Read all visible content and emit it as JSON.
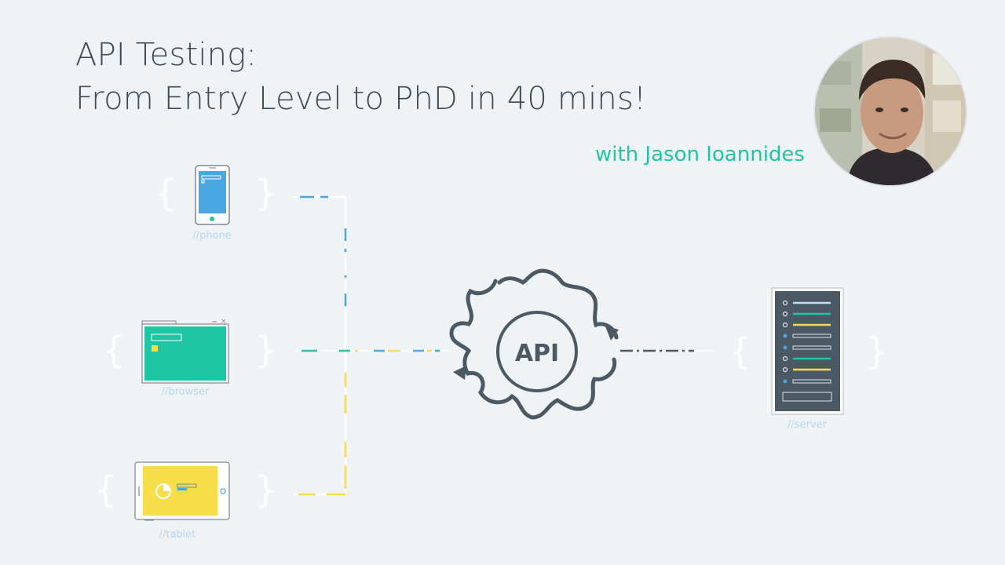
{
  "title": {
    "line1": "API Testing:",
    "line2": "From Entry Level to PhD in 40 mins!"
  },
  "presenter": "with Jason Ioannides",
  "avatar_icon": "presenter-photo",
  "nodes": {
    "phone": "//phone",
    "browser": "//browser",
    "tablet": "//tablet",
    "server": "//server",
    "api": "API"
  },
  "colors": {
    "background": "#eff3f6",
    "title": "#3b4a55",
    "accent_green": "#1fc5a4",
    "blue": "#4aa6e0",
    "yellow": "#f7dd4a",
    "dark": "#4a5963",
    "label": "#b6d6ea"
  }
}
